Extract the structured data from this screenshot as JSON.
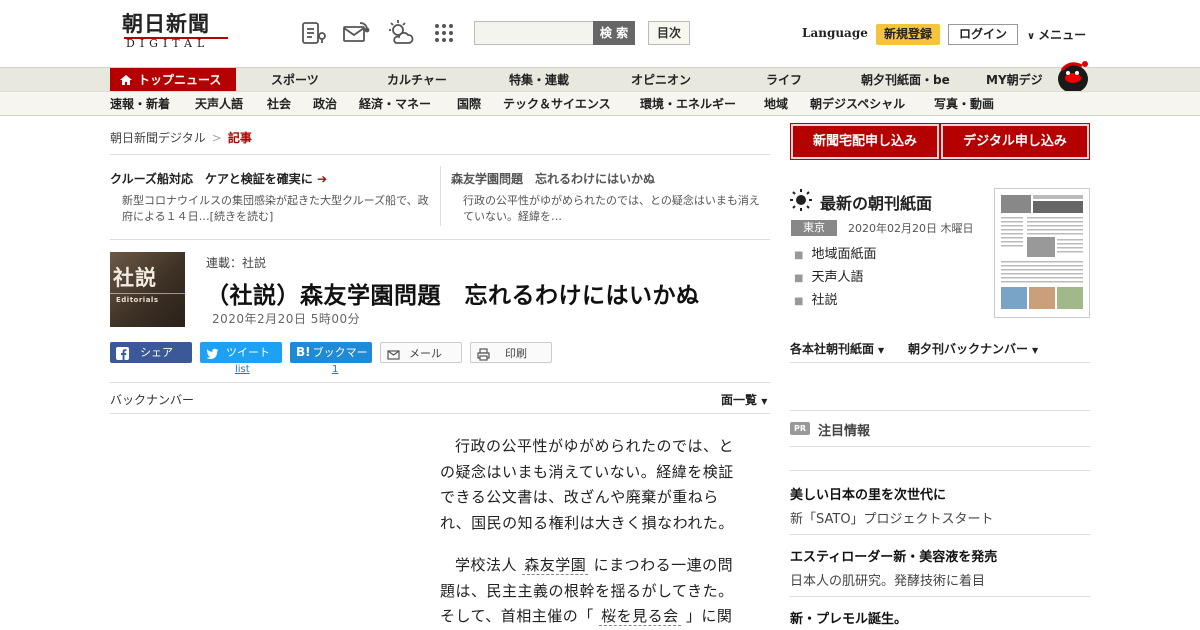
{
  "header": {
    "logo_top": "朝日新聞",
    "logo_bottom": "DIGITAL",
    "icons": [
      "news-app-icon",
      "mail-icon",
      "weather-icon",
      "grid-menu-icon"
    ],
    "search": {
      "placeholder": "",
      "button": "検 索"
    },
    "toc_button": "目次",
    "language": "Language",
    "register": "新規登録",
    "login": "ログイン",
    "menu": "メニュー"
  },
  "nav": {
    "primary": [
      "トップニュース",
      "スポーツ",
      "カルチャー",
      "特集・連載",
      "オピニオン",
      "ライフ",
      "朝夕刊紙面・be",
      "MY朝デジ"
    ],
    "secondary": [
      "速報・新着",
      "天声人語",
      "社会",
      "政治",
      "経済・マネー",
      "国際",
      "テック＆サイエンス",
      "環境・エネルギー",
      "地域",
      "朝デジスペシャル",
      "写真・動画"
    ]
  },
  "breadcrumb": {
    "home": "朝日新聞デジタル",
    "current": "記事"
  },
  "picks": [
    {
      "title": "クルーズ船対応　ケアと検証を確実に",
      "body": "新型コロナウイルスの集団感染が起きた大型クルーズ船で、政府による１４日…[続きを読む]"
    },
    {
      "title": "森友学園問題　忘れるわけにはいかぬ",
      "body": "行政の公平性がゆがめられたのでは、との疑念はいまも消えていない。経緯を…"
    }
  ],
  "article": {
    "thumb_title": "社説",
    "thumb_sub": "Editorials",
    "series": "連載：社説",
    "headline": "（社説）森友学園問題　忘れるわけにはいかぬ",
    "date": "2020年2月20日 5時00分",
    "share": {
      "facebook": "シェア",
      "twitter": "ツイート",
      "twitter_count": "list",
      "hatena": "ブックマーク",
      "hatena_count": "1",
      "mail": "メール",
      "print": "印刷"
    },
    "back_number": "バックナンバー",
    "page_list": "面一覧",
    "paragraphs": [
      {
        "a": "行政の公平性がゆがめられたのでは、との疑念はいまも消えていない。経緯を検証できる公文書は、改ざんや廃棄が重ねられ、国民の知る権利は大きく損なわれた。"
      },
      {
        "a": "学校法人 ",
        "k1": "森友学園",
        "b": " にまつわる一連の問題は、民主主義の根幹を揺るがしてきた。そして、首相主催の「 ",
        "k2": "桜を見る会",
        "c": " 」に関"
      }
    ]
  },
  "sidebar": {
    "subscribe_paper": "新聞宅配申し込み",
    "subscribe_digital": "デジタル申し込み",
    "paper_title": "最新の朝刊紙面",
    "edition": "東京",
    "paper_date": "2020年02月20日 木曜日",
    "paper_links": [
      "地域面紙面",
      "天声人語",
      "社説"
    ],
    "dropdown_1": "各本社朝刊紙面",
    "dropdown_2": "朝夕刊バックナンバー",
    "pr_badge": "PR",
    "pr_title": "注目情報",
    "ads": [
      {
        "title": "美しい日本の里を次世代に",
        "sub": "新「SATO」プロジェクトスタート"
      },
      {
        "title": "エスティローダー新・美容液を発売",
        "sub": "日本人の肌研究。発酵技術に着目"
      },
      {
        "title": "新・プレモル誕生。",
        "sub": ""
      }
    ]
  },
  "colors": {
    "brand_red": "#b40000",
    "nav_bg": "#e9e8df",
    "register_yellow": "#f4c53a",
    "facebook": "#3b5998",
    "twitter": "#1da1f2",
    "hatena": "#1f8bd6"
  }
}
